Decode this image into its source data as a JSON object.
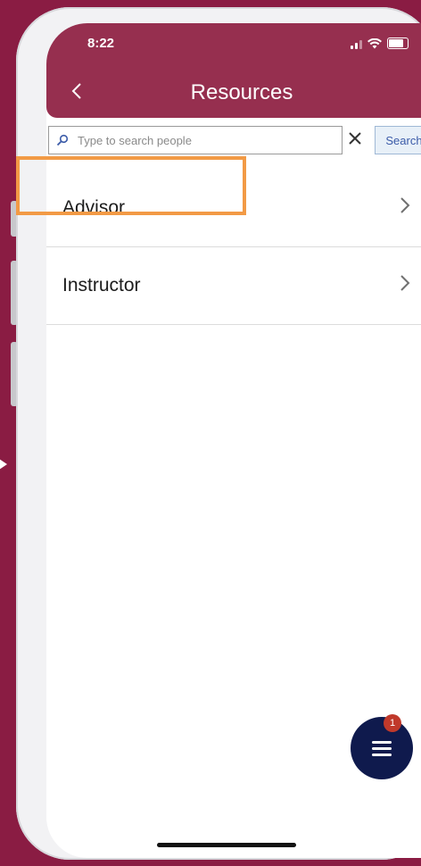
{
  "status_bar": {
    "time": "8:22",
    "battery_level": 0.8
  },
  "header": {
    "title": "Resources",
    "back_icon": "chevron-left-icon"
  },
  "search": {
    "placeholder": "Type to search people",
    "value": "",
    "clear_icon": "close-icon",
    "button_label": "Search"
  },
  "list": {
    "items": [
      {
        "label": "Advisor",
        "icon": "chevron-right-icon",
        "highlighted": true
      },
      {
        "label": "Instructor",
        "icon": "chevron-right-icon",
        "highlighted": false
      }
    ]
  },
  "fab": {
    "icon": "menu-icon",
    "badge_count": "1"
  },
  "colors": {
    "background": "#8a1c43",
    "header": "#962f4f",
    "highlight": "#f29a45",
    "fab": "#0f1a4d",
    "badge": "#c0392b"
  }
}
